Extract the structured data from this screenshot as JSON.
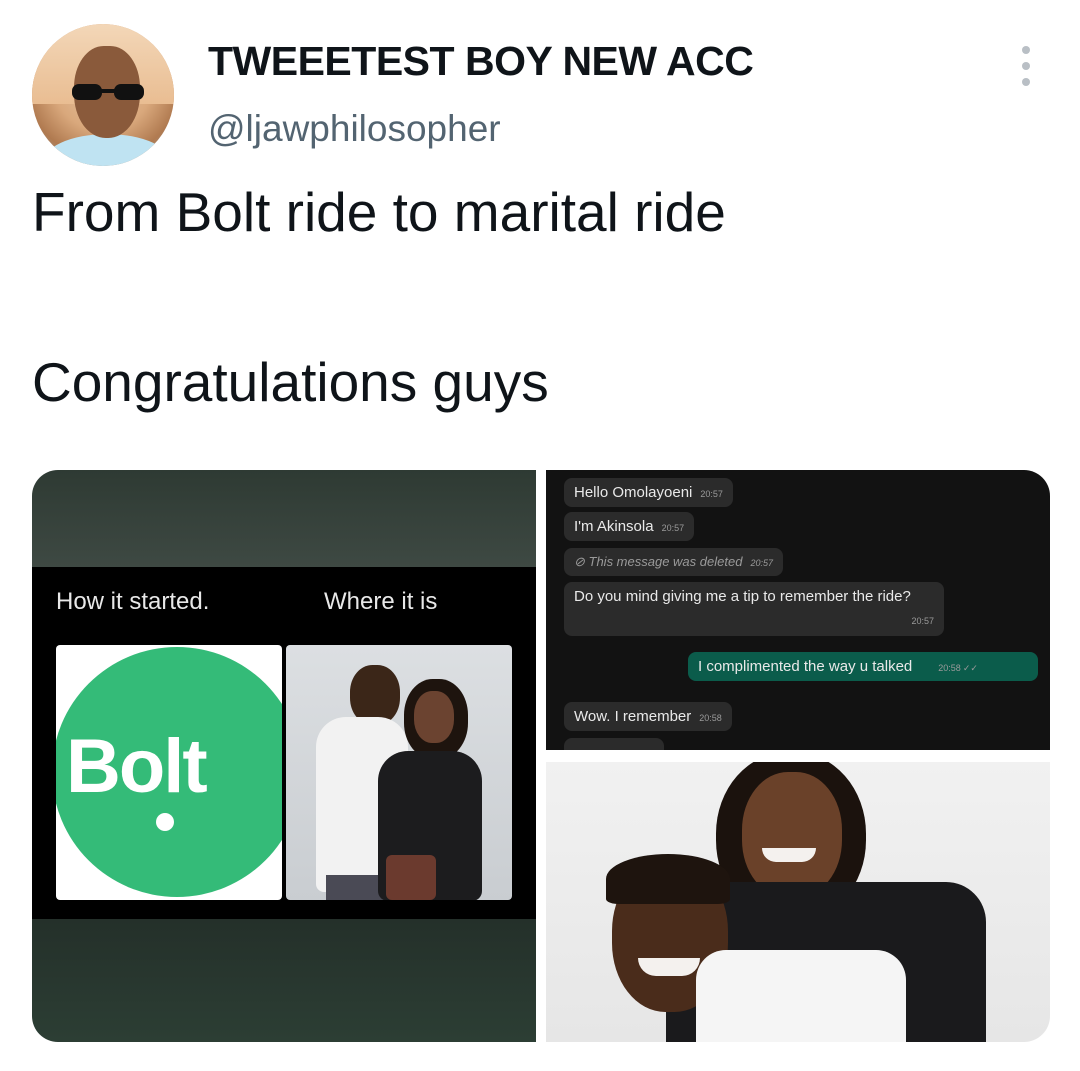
{
  "author": {
    "display_name": "TWEEETEST BOY NEW ACC",
    "handle": "@ljawphilosopher"
  },
  "tweet": {
    "line1": "From Bolt ride to marital ride",
    "line2": "Congratulations guys"
  },
  "media": {
    "meme": {
      "left_label": "How it started.",
      "right_label": "Where it is",
      "logo_text": "Bolt"
    },
    "chat": {
      "messages": [
        {
          "text": "Hello Omolayoeni",
          "time": "20:57",
          "kind": "received"
        },
        {
          "text": "I'm Akinsola",
          "time": "20:57",
          "kind": "received"
        },
        {
          "text": "This message was deleted",
          "time": "20:57",
          "kind": "deleted"
        },
        {
          "text": "Do you mind giving me a tip to remember the ride?",
          "time": "20:57",
          "kind": "received"
        },
        {
          "text": "I complimented the way u talked",
          "time": "20:58",
          "kind": "sent"
        },
        {
          "text": "Wow. I remember",
          "time": "20:58",
          "kind": "received"
        }
      ]
    }
  },
  "colors": {
    "bolt_green": "#34bb78",
    "sent_bubble": "#0b5c4b",
    "received_bubble": "#2b2b2b"
  },
  "icons": {
    "more": "more-vertical-icon",
    "deleted": "blocked-icon",
    "read": "double-check-icon"
  }
}
